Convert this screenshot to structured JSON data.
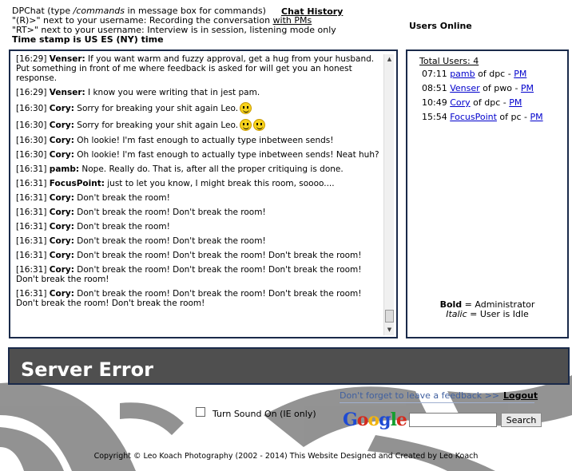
{
  "header": {
    "line1_prefix": "DPChat (type ",
    "line1_italic": "/commands",
    "line1_suffix": " in message box for commands)",
    "line2_prefix": "\"(R)>\" next to your username: Recording the conversation ",
    "line2_link": "with PMs",
    "line3": "\"RT>\" next to your username: Interview is in session, listening mode only",
    "line4": "Time stamp is US ES (NY) time",
    "chat_history": "Chat History",
    "users_online": "Users Online"
  },
  "chat": {
    "messages": [
      {
        "time": "[16:29]",
        "user": "Venser:",
        "text": " If you want warm and fuzzy approval, get a hug from your husband. Put something in front of me where feedback is asked for will get you an honest response."
      },
      {
        "time": "[16:29]",
        "user": "Venser:",
        "text": " I know you were writing that in jest pam."
      },
      {
        "time": "[16:30]",
        "user": "Cory:",
        "text": " Sorry for breaking your shit again Leo."
      },
      {
        "time": "[16:30]",
        "user": "Cory:",
        "text": " Sorry for breaking your shit again Leo."
      },
      {
        "time": "[16:30]",
        "user": "Cory:",
        "text": " Oh lookie! I'm fast enough to actually type inbetween sends!"
      },
      {
        "time": "[16:30]",
        "user": "Cory:",
        "text": " Oh lookie! I'm fast enough to actually type inbetween sends! Neat huh?"
      },
      {
        "time": "[16:31]",
        "user": "pamb:",
        "text": " Nope. Really do. That is, after all the proper critiquing is done."
      },
      {
        "time": "[16:31]",
        "user": "FocusPoint:",
        "text": " just to let you know, I might break this room, soooo...."
      },
      {
        "time": "[16:31]",
        "user": "Cory:",
        "text": " Don't break the room!"
      },
      {
        "time": "[16:31]",
        "user": "Cory:",
        "text": " Don't break the room! Don't break the room!"
      },
      {
        "time": "[16:31]",
        "user": "Cory:",
        "text": " Don't break the room!"
      },
      {
        "time": "[16:31]",
        "user": "Cory:",
        "text": " Don't break the room! Don't break the room!"
      },
      {
        "time": "[16:31]",
        "user": "Cory:",
        "text": " Don't break the room! Don't break the room! Don't break the room!"
      },
      {
        "time": "[16:31]",
        "user": "Cory:",
        "text": " Don't break the room! Don't break the room! Don't break the room! Don't break the room!"
      },
      {
        "time": "[16:31]",
        "user": "Cory:",
        "text": " Don't break the room! Don't break the room! Don't break the room! Don't break the room! Don't break the room!"
      }
    ]
  },
  "users": {
    "total": "Total Users: 4",
    "list": [
      {
        "time": "07:11",
        "name": "pamb",
        "mid": " of dpc - ",
        "pm": "PM"
      },
      {
        "time": "08:51",
        "name": "Venser",
        "mid": " of pwo - ",
        "pm": "PM"
      },
      {
        "time": "10:49",
        "name": "Cory",
        "mid": " of dpc - ",
        "pm": "PM"
      },
      {
        "time": "15:54",
        "name": "FocusPoint",
        "mid": " of pc - ",
        "pm": "PM"
      }
    ],
    "legend_bold": "Bold",
    "legend_bold_text": " = Administrator",
    "legend_italic": "Italic",
    "legend_italic_text": " = User is Idle"
  },
  "error": {
    "title": "Server Error"
  },
  "footer": {
    "feedback": "Don't forget to leave a feedback >>",
    "logout": "Logout",
    "sound": "Turn Sound On (IE only)",
    "google": [
      "G",
      "o",
      "o",
      "g",
      "l",
      "e"
    ],
    "search_button": "Search",
    "copyright": "Copyright © Leo Koach Photography (2002 - 2014) This Website Designed and Created by Leo Koach"
  }
}
